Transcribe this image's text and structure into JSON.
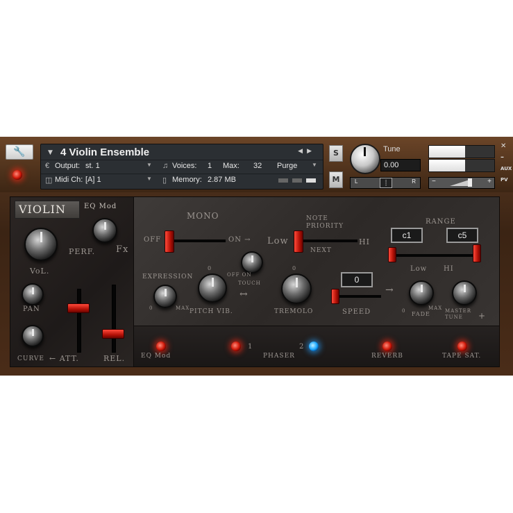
{
  "header": {
    "instrument_name": "4 Violin Ensemble",
    "output_label": "Output:",
    "output_value": "st. 1",
    "voices_label": "Voices:",
    "voices_value": "1",
    "max_label": "Max:",
    "max_value": "32",
    "purge_label": "Purge",
    "midi_label": "Midi Ch:",
    "midi_value": "[A]  1",
    "memory_label": "Memory:",
    "memory_value": "2.87 MB",
    "solo_label": "S",
    "mute_label": "M",
    "tune_label": "Tune",
    "tune_value": "0.00",
    "pan_left": "L",
    "pan_right": "R",
    "aux_label": "AUX",
    "pv_label": "PV",
    "minus": "−",
    "plus": "+"
  },
  "left_panel": {
    "title": "VIOLIN",
    "eq_mod": "EQ Mod",
    "perf": "PERF.",
    "fx": "Fx",
    "vol": "VoL.",
    "pan": "PAN",
    "curve": "CURVE",
    "att": "← ATT.",
    "rel": "REL."
  },
  "main_panel": {
    "mono": "MONO",
    "off": "OFF",
    "on": "ON →",
    "low": "Low",
    "note_priority": "NOTE PRIORITY",
    "next": "NEXT",
    "hi": "HI",
    "range": "RANGE",
    "range_low_value": "c1",
    "range_high_value": "c5",
    "range_low_label": "Low",
    "range_hi_label": "HI",
    "expression": "EXPRESSION",
    "expr_zero": "0",
    "expr_max": "MAX",
    "pitch_vib": "PITCH VIB.",
    "pv_zero": "0",
    "off_on": "OFF   ON",
    "touch": "TOUCH",
    "tremolo": "TREMOLO",
    "trem_zero": "0",
    "speed": "SPEED",
    "speed_value": "0",
    "fade": "FADE",
    "fade_zero": "0",
    "fade_max": "MAX",
    "master_tune": "MASTER TUNE",
    "plus": "+"
  },
  "bottom_panel": {
    "eq_mod": "EQ  Mod",
    "phaser": "PHASER",
    "phaser_1": "1",
    "phaser_2": "2",
    "reverb": "REVERB",
    "tape_sat": "TAPE SAT."
  },
  "colors": {
    "led_red": "#e0180a",
    "led_blue": "#1aa6ff",
    "fader_red": "#c21a0c",
    "wood": "#4a2c18"
  }
}
